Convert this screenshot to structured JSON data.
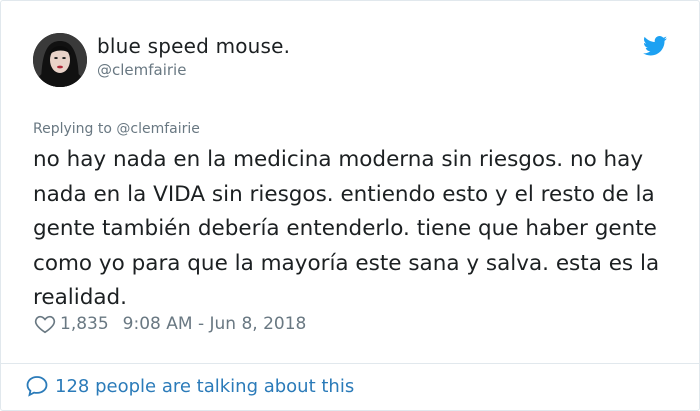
{
  "author": {
    "display_name": "blue speed mouse.",
    "handle": "@clemfairie"
  },
  "reply": {
    "prefix": "Replying to",
    "to_handle": "@clemfairie",
    "text": "Replying to @clemfairie"
  },
  "tweet": {
    "text": "no hay nada en la medicina moderna sin riesgos. no hay nada en la VIDA sin riesgos. entiendo esto y el resto de la gente también debería entenderlo. tiene que haber gente como yo para que la mayoría este sana y salva. esta es la realidad.",
    "likes": "1,835",
    "timestamp": "9:08 AM - Jun 8, 2018"
  },
  "footer": {
    "talking_text": "128 people are talking about this"
  },
  "icons": {
    "bird": "twitter-bird-icon",
    "heart": "heart-icon",
    "bubble": "comment-bubble-icon"
  },
  "colors": {
    "twitter_blue": "#1da1f2",
    "link_blue": "#2b7bb9",
    "text": "#1c2022",
    "muted": "#697882",
    "border": "#e1e8ed"
  }
}
